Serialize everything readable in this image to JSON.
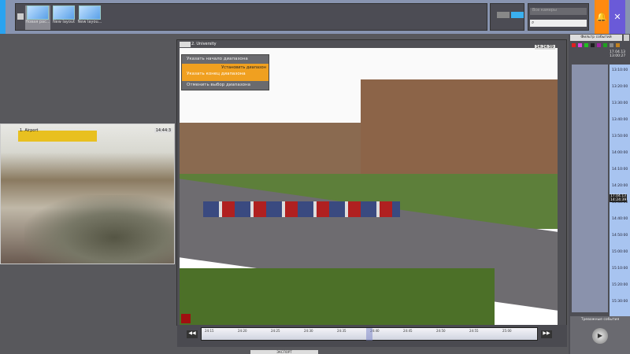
{
  "toolbar": {
    "layouts": [
      {
        "label": "Новая рас..."
      },
      {
        "label": "New layout"
      },
      {
        "label": "New layou..."
      }
    ],
    "camera_select_placeholder": "Все камеры",
    "search_placeholder": ""
  },
  "left_camera": {
    "name": "1. Airport",
    "time": "14:44:3"
  },
  "main_camera": {
    "name": "2. University",
    "time": "14:24:39"
  },
  "context_menu": {
    "items": [
      "Указать начало диапазона",
      "Указать конец диапазона",
      "Отменить выбор диапазона"
    ],
    "tooltip": "Установить диапазон"
  },
  "timeline": {
    "ticks": [
      "24:15",
      "24:20",
      "24:25",
      "24:30",
      "24:35",
      "24:40",
      "24:45",
      "24:50",
      "24:55",
      "25:00"
    ],
    "button_label": "ЭКСПОРТ"
  },
  "right_panel": {
    "filter_label": "Фильтр событий",
    "current_date": "17.04.13",
    "current_time": "13:00:27",
    "cursor_date": "17.04.13",
    "cursor_time": "14:24:39",
    "ruler": [
      "13:10:00",
      "13:20:00",
      "13:30:00",
      "13:40:00",
      "13:50:00",
      "14:00:00",
      "14:10:00",
      "14:20:00",
      "14:30:00",
      "14:40:00",
      "14:50:00",
      "15:00:00",
      "15:10:00",
      "15:20:00",
      "15:30:00"
    ],
    "alarm_label": "Тревожные события",
    "event_colors": [
      "#e02020",
      "#e040e0",
      "#20c020",
      "#202020",
      "#a020a0",
      "#20a020",
      "#888888",
      "#c08020"
    ]
  },
  "bottom_tab": "ЭКСПОРТ",
  "colors": {
    "accent_blue": "#2aa3f0",
    "alarm_orange": "#ff8a10",
    "settings_purple": "#6a5ad8",
    "menu_highlight": "#f0a020"
  }
}
